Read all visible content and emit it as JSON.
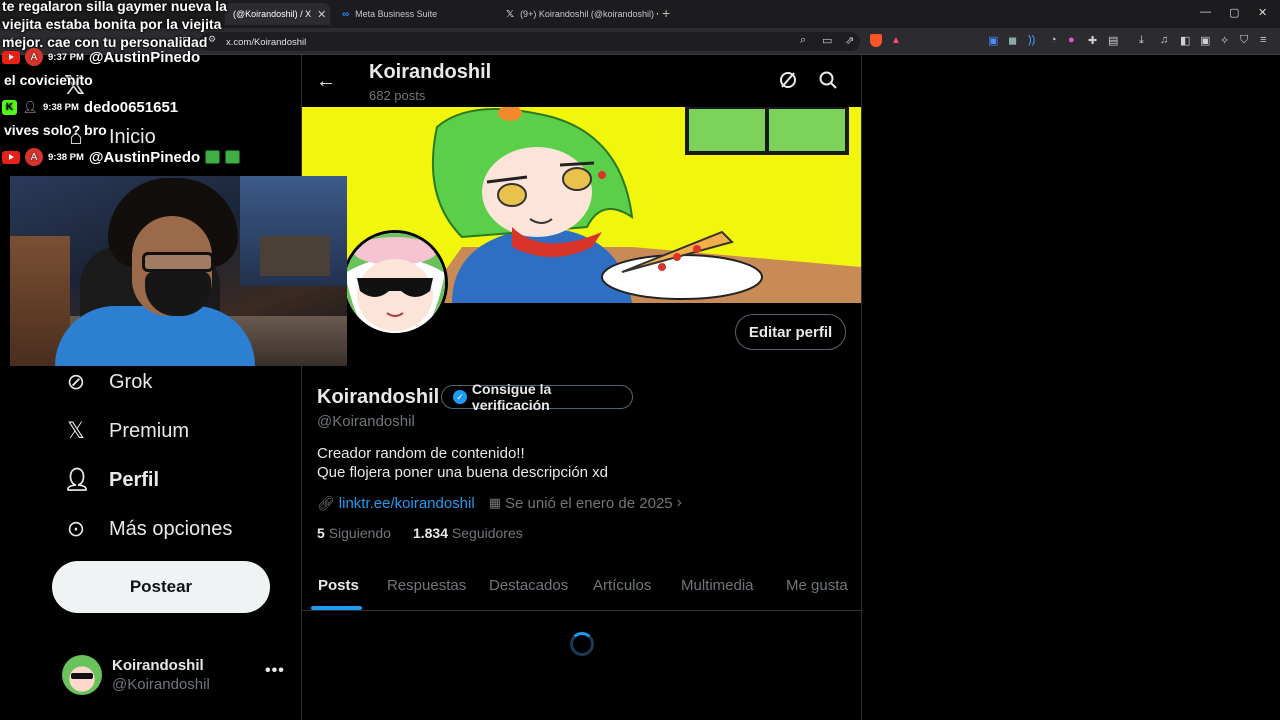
{
  "browser": {
    "tabs": [
      {
        "label": "(@Koirandoshil) / X",
        "active": true
      },
      {
        "label": "Meta Business Suite",
        "active": false
      },
      {
        "label": "(9+) Koirandoshil (@koirandoshil) • T",
        "active": false
      }
    ],
    "url": "x.com/Koirandoshil",
    "new_tab": "+"
  },
  "chat": {
    "top_message": "te regalaron silla gaymer nueva la viejita estaba bonita por la viejita mejor. cae con tu personalidad",
    "lines": [
      {
        "platform": "youtube",
        "avatar": "A",
        "time": "9:37 PM",
        "name": "@AustinPinedo",
        "message": "el covicienito"
      },
      {
        "platform": "kick",
        "avatar": "",
        "time": "9:38 PM",
        "name": "dedo0651651",
        "message": "vives solo? bro"
      },
      {
        "platform": "youtube",
        "avatar": "A",
        "time": "9:38 PM",
        "name": "@AustinPinedo",
        "message": ""
      }
    ]
  },
  "nav": {
    "items": [
      {
        "label": "Inicio",
        "icon": "home-icon"
      },
      {
        "label": "Grok",
        "icon": "grok-icon"
      },
      {
        "label": "Premium",
        "icon": "x-premium-icon"
      },
      {
        "label": "Perfil",
        "icon": "person-icon"
      },
      {
        "label": "Más opciones",
        "icon": "more-circle-icon"
      }
    ],
    "post_button": "Postear",
    "account": {
      "name": "Koirandoshil",
      "handle": "@Koirandoshil",
      "more": "•••"
    }
  },
  "profile": {
    "header_name": "Koirandoshil",
    "header_posts": "682 posts",
    "name": "Koirandoshil",
    "verify_label": "Consigue la verificación",
    "handle": "@Koirandoshil",
    "bio_line1": "Creador random de contenido!!",
    "bio_line2": "Que flojera poner una buena descripción xd",
    "link": "linktr.ee/koirandoshil",
    "joined": "Se unió el enero de 2025",
    "following_count": "5",
    "following_label": "Siguiendo",
    "followers_count": "1.834",
    "followers_label": "Seguidores",
    "edit_button": "Editar perfil",
    "tabs": [
      "Posts",
      "Respuestas",
      "Destacados",
      "Artículos",
      "Multimedia",
      "Me gusta"
    ]
  },
  "colors": {
    "accent": "#1d9bf0",
    "banner": "#f2f50c",
    "bg": "#000000"
  }
}
